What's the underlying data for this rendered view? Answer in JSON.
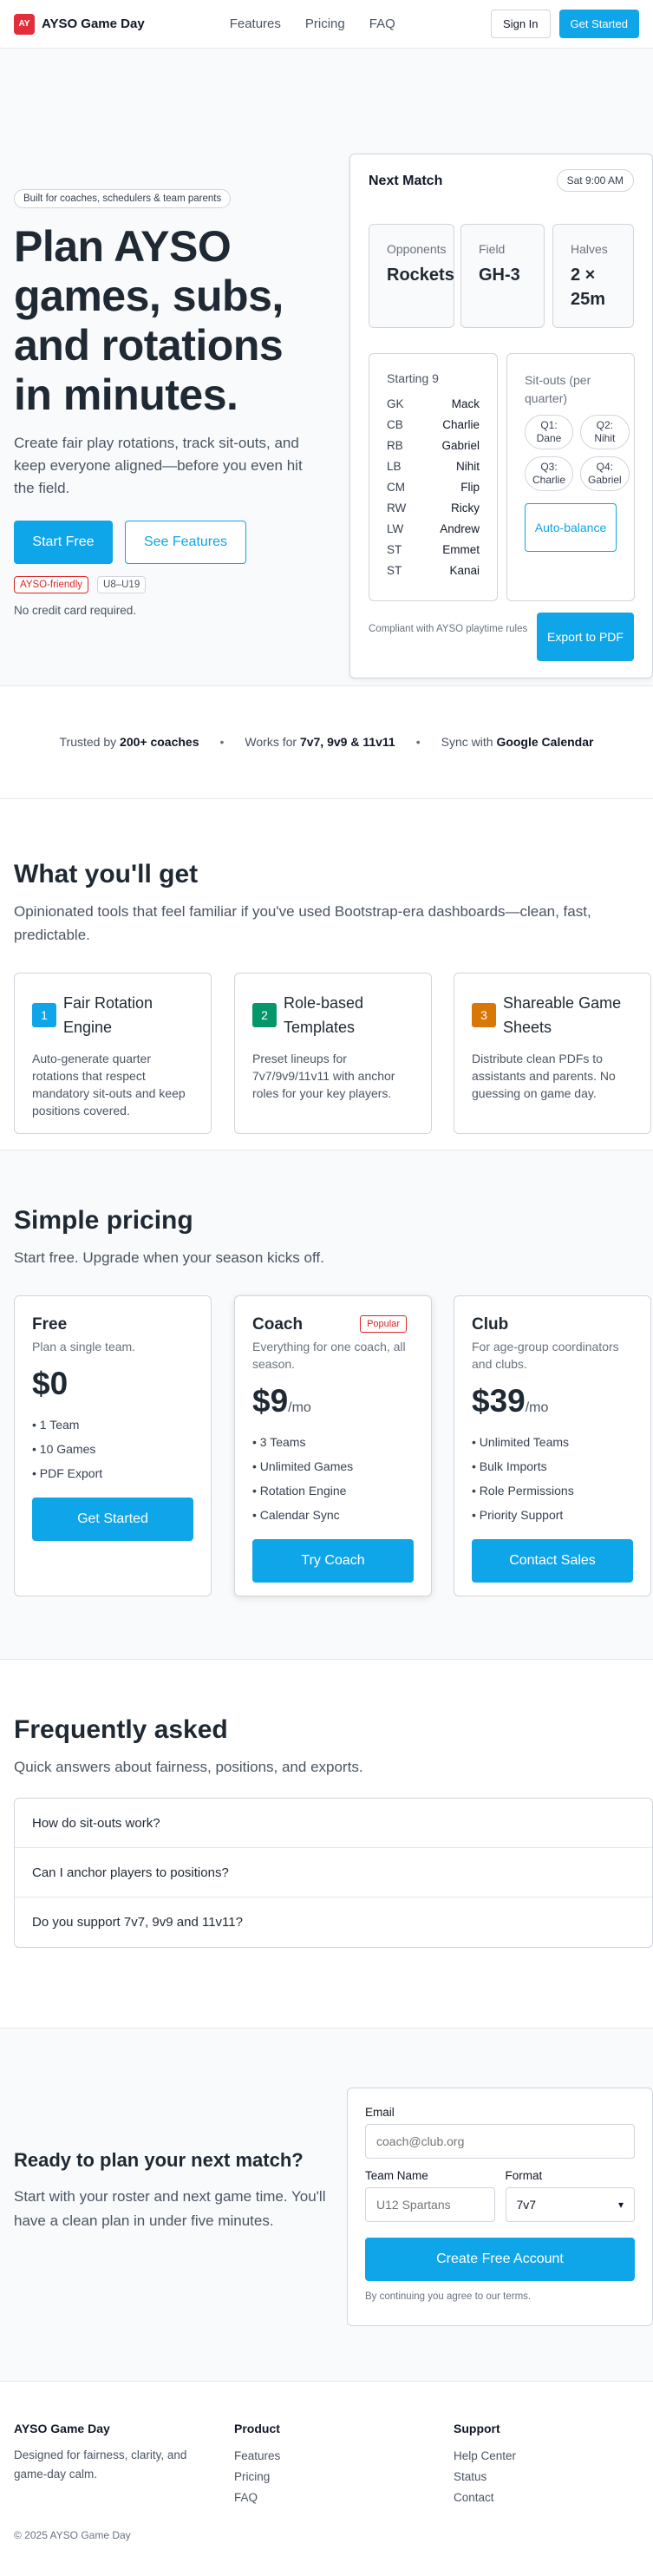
{
  "header": {
    "logo_mark": "AY",
    "brand": "AYSO Game Day",
    "nav": [
      "Features",
      "Pricing",
      "FAQ"
    ],
    "sign_in": "Sign In",
    "get_started": "Get Started"
  },
  "hero": {
    "tag": "Built for coaches, schedulers & team parents",
    "title": "Plan AYSO games, subs, and rotations in minutes.",
    "subtitle": "Create fair play rotations, track sit-outs, and keep everyone aligned—before you even hit the field.",
    "start_free": "Start Free",
    "see_features": "See Features",
    "badge_friendly": "AYSO-friendly",
    "badge_ages": "U8–U19",
    "no_cc": "No credit card required."
  },
  "match_card": {
    "heading": "Next Match",
    "time": "Sat 9:00 AM",
    "stats": [
      {
        "label": "Opponents",
        "value": "Rockets"
      },
      {
        "label": "Field",
        "value": "GH-3"
      },
      {
        "label": "Halves",
        "value": "2 × 25m"
      }
    ],
    "lineup_title": "Starting 9",
    "lineup": [
      {
        "pos": "GK",
        "name": "Mack"
      },
      {
        "pos": "CB",
        "name": "Charlie"
      },
      {
        "pos": "RB",
        "name": "Gabriel"
      },
      {
        "pos": "LB",
        "name": "Nihit"
      },
      {
        "pos": "CM",
        "name": "Flip"
      },
      {
        "pos": "RW",
        "name": "Ricky"
      },
      {
        "pos": "LW",
        "name": "Andrew"
      },
      {
        "pos": "ST",
        "name": "Emmet"
      },
      {
        "pos": "ST",
        "name": "Kanai"
      }
    ],
    "sitouts_title": "Sit-outs (per quarter)",
    "sitouts": [
      "Q1: Dane",
      "Q2: Nihit",
      "Q3: Charlie",
      "Q4: Gabriel"
    ],
    "auto_balance": "Auto-balance",
    "compliance": "Compliant with AYSO playtime rules",
    "export": "Export to PDF"
  },
  "trust": {
    "t1_pre": "Trusted by ",
    "t1_bold": "200+ coaches",
    "t2_pre": "Works for ",
    "t2_bold": "7v7, 9v9 & 11v11",
    "t3_pre": "Sync with ",
    "t3_bold": "Google Calendar"
  },
  "features": {
    "title": "What you'll get",
    "subtitle": "Opinionated tools that feel familiar if you've used Bootstrap-era dashboards—clean, fast, predictable.",
    "items": [
      {
        "num": "1",
        "title": "Fair Rotation Engine",
        "desc": "Auto-generate quarter rotations that respect mandatory sit-outs and keep positions covered.",
        "color": "#0ea5e9"
      },
      {
        "num": "2",
        "title": "Role-based Templates",
        "desc": "Preset lineups for 7v7/9v9/11v11 with anchor roles for your key players.",
        "color": "#059669"
      },
      {
        "num": "3",
        "title": "Shareable Game Sheets",
        "desc": "Distribute clean PDFs to assistants and parents. No guessing on game day.",
        "color": "#d97706"
      }
    ]
  },
  "pricing": {
    "title": "Simple pricing",
    "subtitle": "Start free. Upgrade when your season kicks off.",
    "popular": "Popular",
    "plans": [
      {
        "name": "Free",
        "desc": "Plan a single team.",
        "price": "$0",
        "unit": "",
        "features": [
          "1 Team",
          "10 Games",
          "PDF Export"
        ],
        "cta": "Get Started"
      },
      {
        "name": "Coach",
        "desc": "Everything for one coach, all season.",
        "price": "$9",
        "unit": "/mo",
        "features": [
          "3 Teams",
          "Unlimited Games",
          "Rotation Engine",
          "Calendar Sync"
        ],
        "cta": "Try Coach"
      },
      {
        "name": "Club",
        "desc": "For age-group coordinators and clubs.",
        "price": "$39",
        "unit": "/mo",
        "features": [
          "Unlimited Teams",
          "Bulk Imports",
          "Role Permissions",
          "Priority Support"
        ],
        "cta": "Contact Sales"
      }
    ]
  },
  "faq": {
    "title": "Frequently asked",
    "subtitle": "Quick answers about fairness, positions, and exports.",
    "items": [
      "How do sit-outs work?",
      "Can I anchor players to positions?",
      "Do you support 7v7, 9v9 and 11v11?"
    ]
  },
  "cta": {
    "title": "Ready to plan your next match?",
    "subtitle": "Start with your roster and next game time. You'll have a clean plan in under five minutes.",
    "email_label": "Email",
    "email_placeholder": "coach@club.org",
    "team_label": "Team Name",
    "team_placeholder": "U12 Spartans",
    "format_label": "Format",
    "format_value": "7v7",
    "submit": "Create Free Account",
    "note": "By continuing you agree to our terms."
  },
  "footer": {
    "brand": "AYSO Game Day",
    "tagline": "Designed for fairness, clarity, and game-day calm.",
    "product_title": "Product",
    "product_links": [
      "Features",
      "Pricing",
      "FAQ"
    ],
    "support_title": "Support",
    "support_links": [
      "Help Center",
      "Status",
      "Contact"
    ],
    "copyright": "© 2025 AYSO Game Day"
  }
}
